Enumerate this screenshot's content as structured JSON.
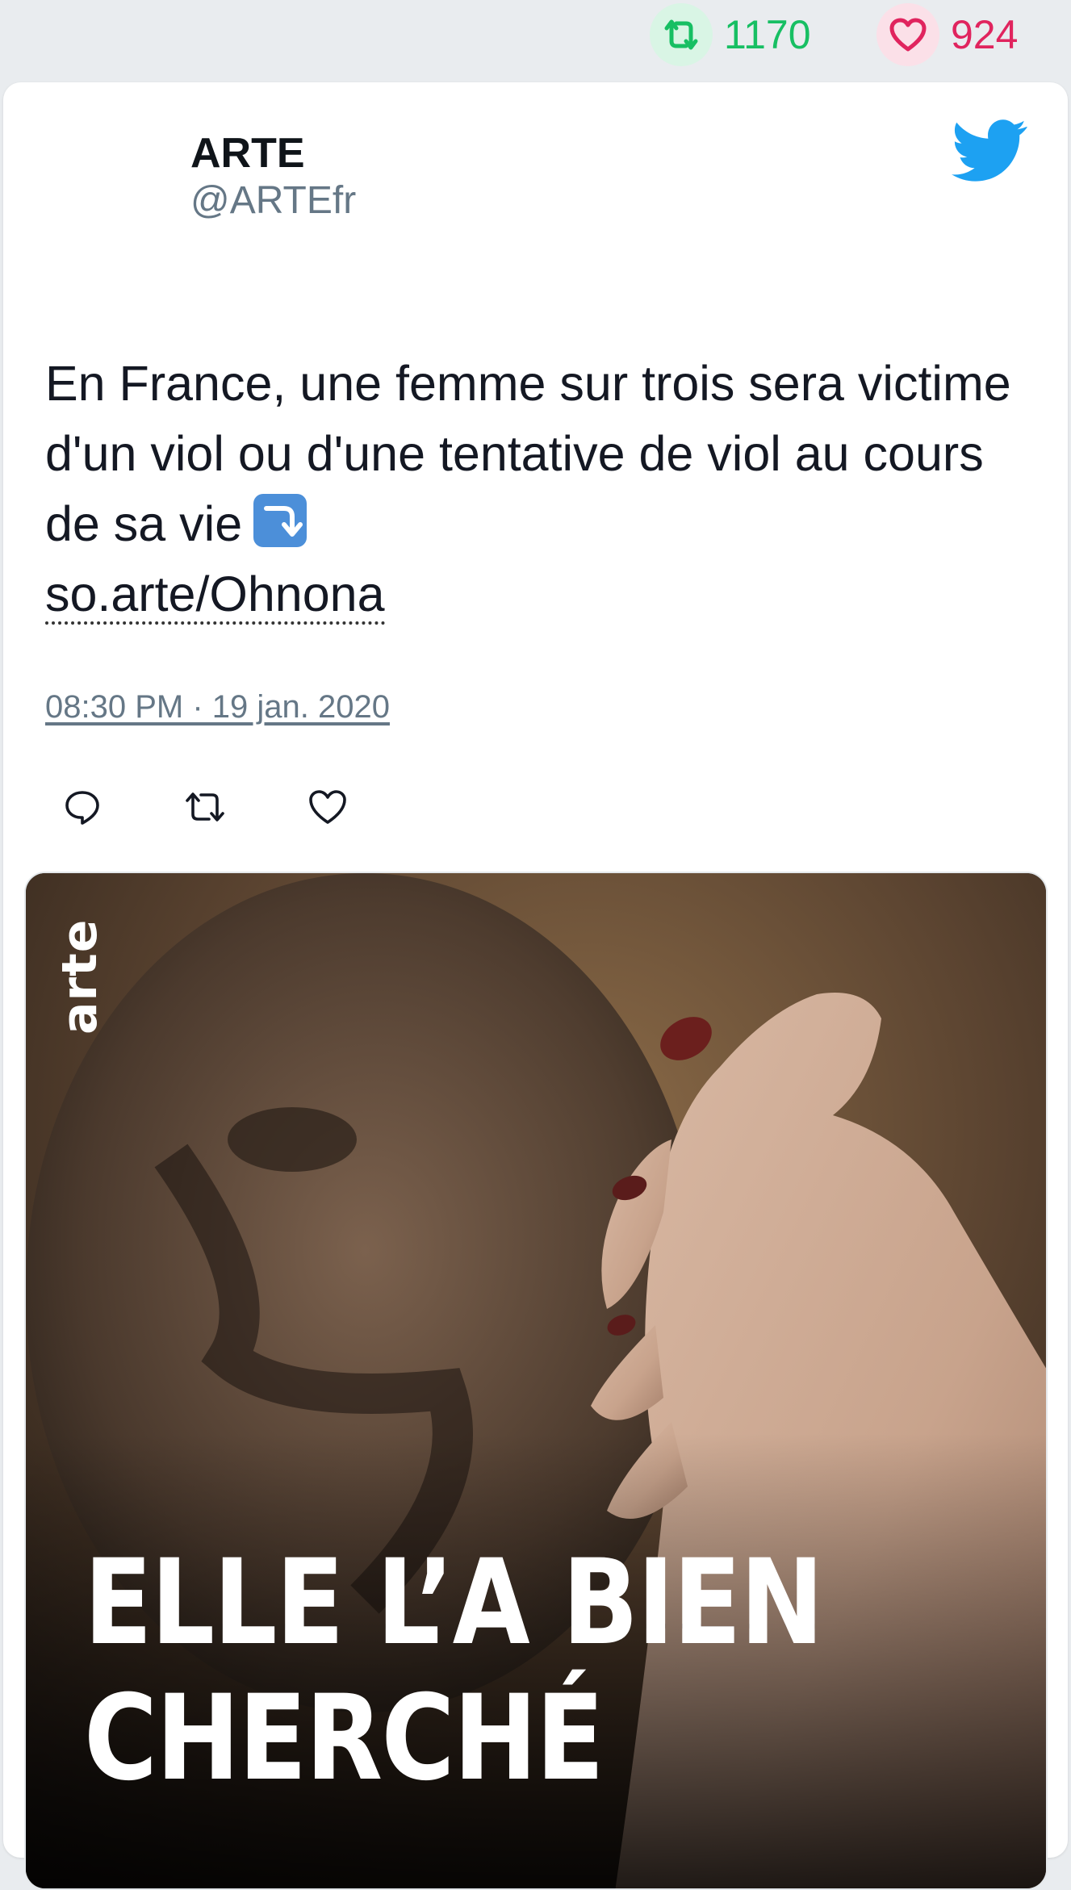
{
  "stats": {
    "retweets": "1170",
    "likes": "924",
    "retweet_icon": "retweet-icon",
    "like_icon": "heart-icon",
    "retweet_color": "#17bf63",
    "like_color": "#e0245e"
  },
  "tweet": {
    "author_name": "ARTE",
    "author_handle": "@ARTEfr",
    "text_line": "En France, une femme sur trois sera victime d'un viol ou d'une tentative de viol au cours de sa vie",
    "emoji": "⤵️",
    "link": "so.arte/Ohnona",
    "timestamp": "08:30 PM · 19 jan. 2020",
    "platform_icon": "twitter-bird-icon",
    "platform_color": "#1da1f2"
  },
  "actions": {
    "reply_icon": "reply-icon",
    "retweet_icon": "retweet-icon",
    "like_icon": "heart-icon"
  },
  "media": {
    "logo_text": "arte",
    "headline_line1": "ELLE L’A BIEN",
    "headline_line2": "CHERCHÉ"
  }
}
